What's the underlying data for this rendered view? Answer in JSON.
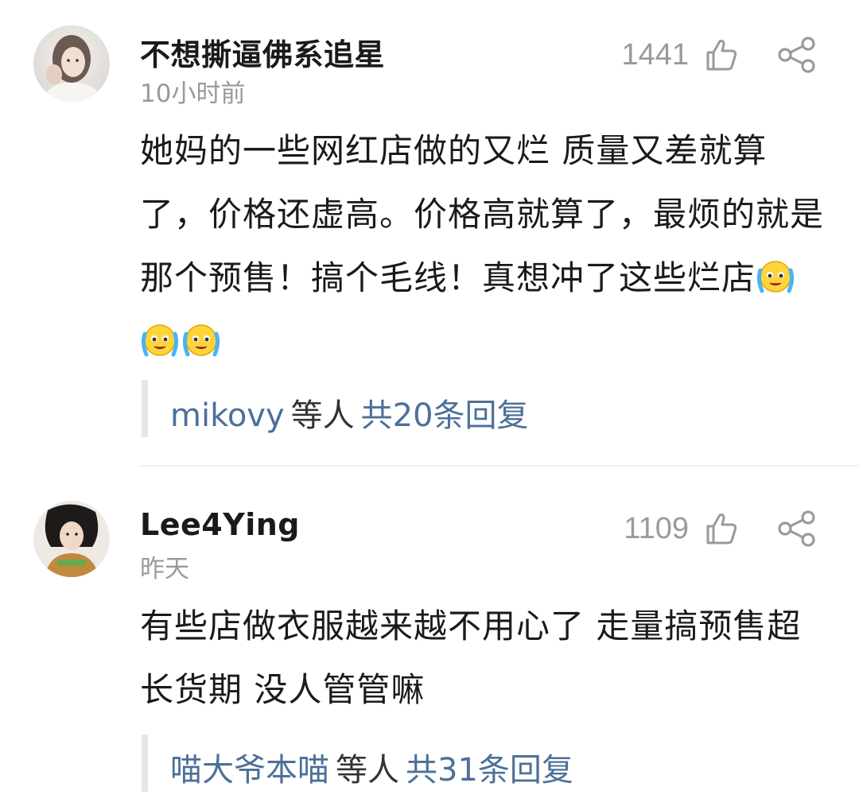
{
  "comments": [
    {
      "username": "不想撕逼佛系追星",
      "time": "10小时前",
      "likes": "1441",
      "text_parts": [
        "她妈的一些网红店做的又烂 质量又差就算了，价格还虚高。价格高就算了，最烦的就是那个预售！搞个毛线！真想冲了这些烂店"
      ],
      "emojis": [
        "crying-emoji",
        "crying-emoji",
        "crying-emoji"
      ],
      "reply_users": "mikovy",
      "reply_mid": "等人",
      "reply_link": "共20条回复"
    },
    {
      "username": "Lee4Ying",
      "time": "昨天",
      "likes": "1109",
      "text_parts": [
        "有些店做衣服越来越不用心了 走量搞预售超长货期 没人管管嘛"
      ],
      "emojis": [],
      "reply_users": "喵大爷本喵",
      "reply_mid": "等人",
      "reply_link": "共31条回复"
    }
  ],
  "colors": {
    "link": "#4c7099",
    "meta": "#9a9a9a",
    "text": "#1a1a1a"
  },
  "icons": {
    "like": "thumbs-up-icon",
    "share": "share-icon"
  }
}
